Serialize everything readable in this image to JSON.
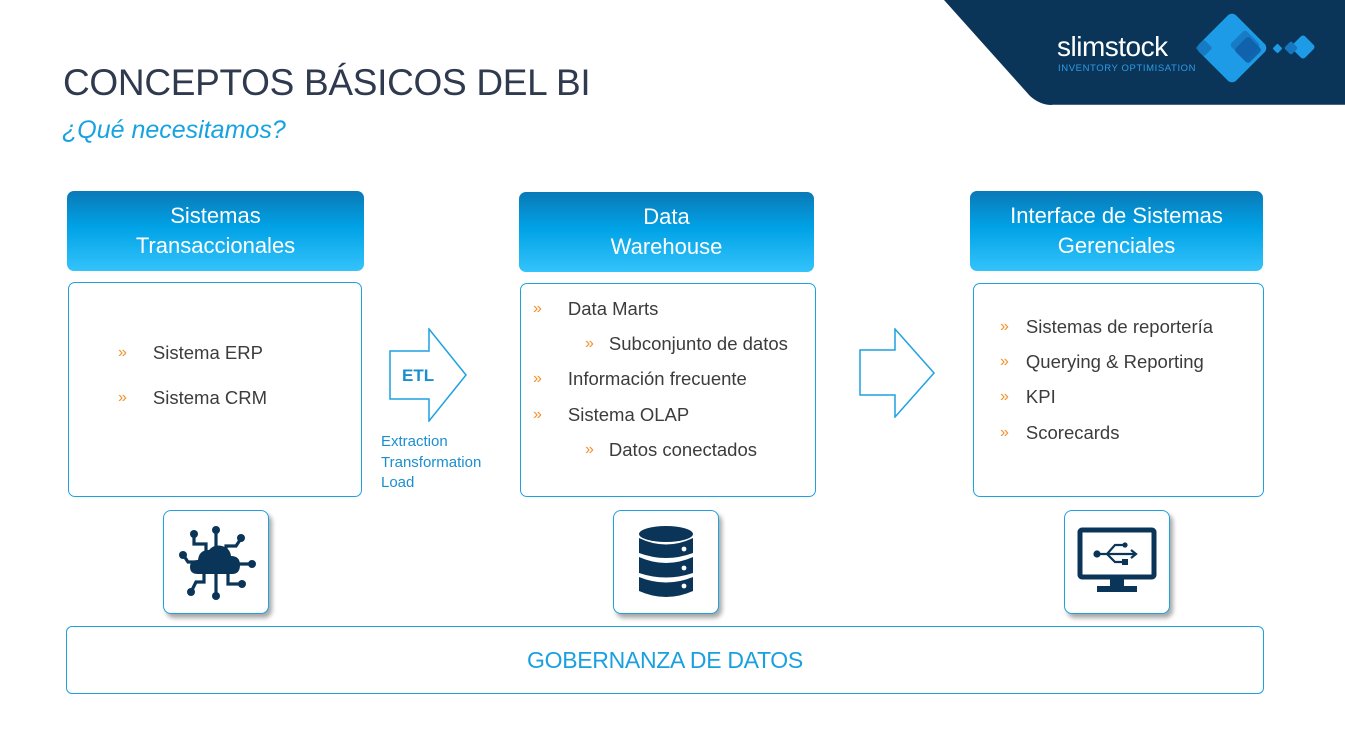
{
  "brand": {
    "name": "slimstock",
    "tagline": "INVENTORY OPTIMISATION",
    "colors": {
      "navy": "#0b3558",
      "accent": "#1e9be6"
    }
  },
  "slide": {
    "title": "CONCEPTOS BÁSICOS DEL BI",
    "subtitle": "¿Qué necesitamos?"
  },
  "columns": [
    {
      "header_line1": "Sistemas",
      "header_line2": "Transaccionales",
      "items": [
        {
          "level": 1,
          "text": "Sistema ERP"
        },
        {
          "level": 1,
          "text": "Sistema CRM"
        }
      ],
      "icon": "cloud-network-icon"
    },
    {
      "header_line1": "Data",
      "header_line2": "Warehouse",
      "items": [
        {
          "level": 1,
          "text": "Data Marts"
        },
        {
          "level": 2,
          "text": "Subconjunto de datos"
        },
        {
          "level": 1,
          "text": "Información frecuente"
        },
        {
          "level": 1,
          "text": "Sistema OLAP"
        },
        {
          "level": 2,
          "text": "Datos conectados"
        }
      ],
      "icon": "database-icon"
    },
    {
      "header_line1": "Interface de Sistemas",
      "header_line2": "Gerenciales",
      "items": [
        {
          "level": 1,
          "text": "Sistemas de reportería"
        },
        {
          "level": 1,
          "text": "Querying & Reporting"
        },
        {
          "level": 1,
          "text": "KPI"
        },
        {
          "level": 1,
          "text": "Scorecards"
        }
      ],
      "icon": "monitor-usb-icon"
    }
  ],
  "bullet_glyph": "»",
  "etl": {
    "label": "ETL",
    "desc_lines": [
      "Extraction",
      "Transformation",
      "Load"
    ]
  },
  "footer": {
    "label": "GOBERNANZA DE DATOS"
  }
}
